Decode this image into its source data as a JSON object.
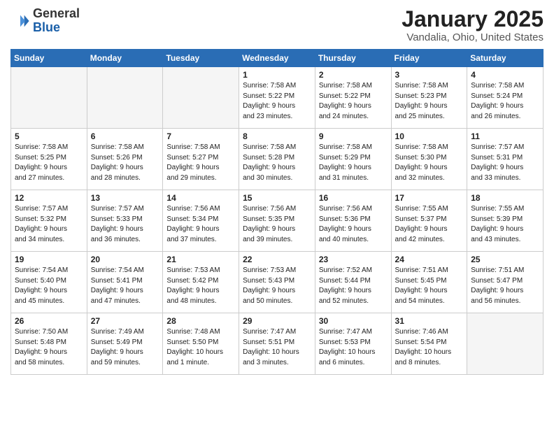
{
  "logo": {
    "general": "General",
    "blue": "Blue"
  },
  "title": "January 2025",
  "subtitle": "Vandalia, Ohio, United States",
  "days_header": [
    "Sunday",
    "Monday",
    "Tuesday",
    "Wednesday",
    "Thursday",
    "Friday",
    "Saturday"
  ],
  "weeks": [
    [
      {
        "day": "",
        "info": ""
      },
      {
        "day": "",
        "info": ""
      },
      {
        "day": "",
        "info": ""
      },
      {
        "day": "1",
        "info": "Sunrise: 7:58 AM\nSunset: 5:22 PM\nDaylight: 9 hours\nand 23 minutes."
      },
      {
        "day": "2",
        "info": "Sunrise: 7:58 AM\nSunset: 5:22 PM\nDaylight: 9 hours\nand 24 minutes."
      },
      {
        "day": "3",
        "info": "Sunrise: 7:58 AM\nSunset: 5:23 PM\nDaylight: 9 hours\nand 25 minutes."
      },
      {
        "day": "4",
        "info": "Sunrise: 7:58 AM\nSunset: 5:24 PM\nDaylight: 9 hours\nand 26 minutes."
      }
    ],
    [
      {
        "day": "5",
        "info": "Sunrise: 7:58 AM\nSunset: 5:25 PM\nDaylight: 9 hours\nand 27 minutes."
      },
      {
        "day": "6",
        "info": "Sunrise: 7:58 AM\nSunset: 5:26 PM\nDaylight: 9 hours\nand 28 minutes."
      },
      {
        "day": "7",
        "info": "Sunrise: 7:58 AM\nSunset: 5:27 PM\nDaylight: 9 hours\nand 29 minutes."
      },
      {
        "day": "8",
        "info": "Sunrise: 7:58 AM\nSunset: 5:28 PM\nDaylight: 9 hours\nand 30 minutes."
      },
      {
        "day": "9",
        "info": "Sunrise: 7:58 AM\nSunset: 5:29 PM\nDaylight: 9 hours\nand 31 minutes."
      },
      {
        "day": "10",
        "info": "Sunrise: 7:58 AM\nSunset: 5:30 PM\nDaylight: 9 hours\nand 32 minutes."
      },
      {
        "day": "11",
        "info": "Sunrise: 7:57 AM\nSunset: 5:31 PM\nDaylight: 9 hours\nand 33 minutes."
      }
    ],
    [
      {
        "day": "12",
        "info": "Sunrise: 7:57 AM\nSunset: 5:32 PM\nDaylight: 9 hours\nand 34 minutes."
      },
      {
        "day": "13",
        "info": "Sunrise: 7:57 AM\nSunset: 5:33 PM\nDaylight: 9 hours\nand 36 minutes."
      },
      {
        "day": "14",
        "info": "Sunrise: 7:56 AM\nSunset: 5:34 PM\nDaylight: 9 hours\nand 37 minutes."
      },
      {
        "day": "15",
        "info": "Sunrise: 7:56 AM\nSunset: 5:35 PM\nDaylight: 9 hours\nand 39 minutes."
      },
      {
        "day": "16",
        "info": "Sunrise: 7:56 AM\nSunset: 5:36 PM\nDaylight: 9 hours\nand 40 minutes."
      },
      {
        "day": "17",
        "info": "Sunrise: 7:55 AM\nSunset: 5:37 PM\nDaylight: 9 hours\nand 42 minutes."
      },
      {
        "day": "18",
        "info": "Sunrise: 7:55 AM\nSunset: 5:39 PM\nDaylight: 9 hours\nand 43 minutes."
      }
    ],
    [
      {
        "day": "19",
        "info": "Sunrise: 7:54 AM\nSunset: 5:40 PM\nDaylight: 9 hours\nand 45 minutes."
      },
      {
        "day": "20",
        "info": "Sunrise: 7:54 AM\nSunset: 5:41 PM\nDaylight: 9 hours\nand 47 minutes."
      },
      {
        "day": "21",
        "info": "Sunrise: 7:53 AM\nSunset: 5:42 PM\nDaylight: 9 hours\nand 48 minutes."
      },
      {
        "day": "22",
        "info": "Sunrise: 7:53 AM\nSunset: 5:43 PM\nDaylight: 9 hours\nand 50 minutes."
      },
      {
        "day": "23",
        "info": "Sunrise: 7:52 AM\nSunset: 5:44 PM\nDaylight: 9 hours\nand 52 minutes."
      },
      {
        "day": "24",
        "info": "Sunrise: 7:51 AM\nSunset: 5:45 PM\nDaylight: 9 hours\nand 54 minutes."
      },
      {
        "day": "25",
        "info": "Sunrise: 7:51 AM\nSunset: 5:47 PM\nDaylight: 9 hours\nand 56 minutes."
      }
    ],
    [
      {
        "day": "26",
        "info": "Sunrise: 7:50 AM\nSunset: 5:48 PM\nDaylight: 9 hours\nand 58 minutes."
      },
      {
        "day": "27",
        "info": "Sunrise: 7:49 AM\nSunset: 5:49 PM\nDaylight: 9 hours\nand 59 minutes."
      },
      {
        "day": "28",
        "info": "Sunrise: 7:48 AM\nSunset: 5:50 PM\nDaylight: 10 hours\nand 1 minute."
      },
      {
        "day": "29",
        "info": "Sunrise: 7:47 AM\nSunset: 5:51 PM\nDaylight: 10 hours\nand 3 minutes."
      },
      {
        "day": "30",
        "info": "Sunrise: 7:47 AM\nSunset: 5:53 PM\nDaylight: 10 hours\nand 6 minutes."
      },
      {
        "day": "31",
        "info": "Sunrise: 7:46 AM\nSunset: 5:54 PM\nDaylight: 10 hours\nand 8 minutes."
      },
      {
        "day": "",
        "info": ""
      }
    ]
  ]
}
